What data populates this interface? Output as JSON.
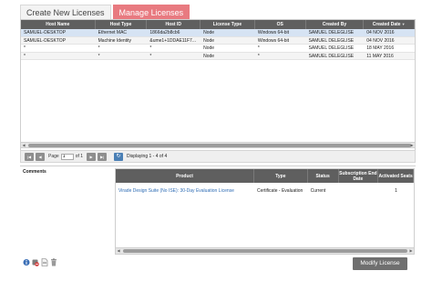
{
  "tabs": [
    {
      "label": "Create New Licenses",
      "active": false
    },
    {
      "label": "Manage Licenses",
      "active": true
    }
  ],
  "grid": {
    "columns": [
      "Host Name",
      "Host Type",
      "Host ID",
      "License Type",
      "OS",
      "Created By",
      "Created Date"
    ],
    "sort_icon": "triangle-down-icon",
    "rows": [
      [
        "SAMUEL-DESKTOP",
        "Ethernet MAC",
        "1866da2b8cb6",
        "Node",
        "Windows 64-bit",
        "SAMUEL DELEGLISE",
        "04 NOV 2016"
      ],
      [
        "SAMUEL-DESKTOP",
        "Machine Identity",
        "&ume1+1DDAE11F7...",
        "Node",
        "Windows 64-bit",
        "SAMUEL DELEGLISE",
        "04 NOV 2016"
      ],
      [
        "*",
        "*",
        "*",
        "Node",
        "*",
        "SAMUEL DELEGLISE",
        "18 MAY 2016"
      ],
      [
        "*",
        "*",
        "*",
        "Node",
        "*",
        "SAMUEL DELEGLISE",
        "11 MAY 2016"
      ]
    ]
  },
  "pager": {
    "page_label": "Page",
    "page_value": "1",
    "of_label": "of 1",
    "displaying": "Displaying 1 - 4 of 4"
  },
  "comments": {
    "label": "Comments"
  },
  "products": {
    "columns": [
      "Product",
      "Type",
      "Status",
      "Subscription End Date",
      "Activated Seats"
    ],
    "rows": [
      [
        "Virade Design Suite (No ISE): 30-Day Evaluation License",
        "Certificate - Evaluation",
        "Current",
        "",
        "1"
      ]
    ]
  },
  "action_icons": [
    "info-icon",
    "remove-icon",
    "document-icon",
    "trash-icon"
  ],
  "modify_button": {
    "label": "Modify License"
  },
  "colors": {
    "accent_tab": "#e87a80",
    "header_bg": "#5f5f5f",
    "selected_row": "#d6e3f3",
    "link": "#2f6db5"
  }
}
